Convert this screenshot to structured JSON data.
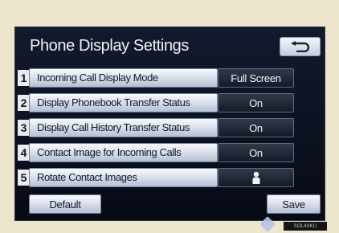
{
  "header": {
    "title": "Phone Display Settings",
    "back_icon": "return-arrow-icon"
  },
  "rows": [
    {
      "number": "1",
      "label": "Incoming Call Display Mode",
      "value": "Full Screen"
    },
    {
      "number": "2",
      "label": "Display Phonebook Transfer Status",
      "value": "On"
    },
    {
      "number": "3",
      "label": "Display Call History Transfer Status",
      "value": "On"
    },
    {
      "number": "4",
      "label": "Contact Image for Incoming Calls",
      "value": "On"
    },
    {
      "number": "5",
      "label": "Rotate Contact Images",
      "value": "",
      "value_icon": "person-icon"
    }
  ],
  "footer": {
    "default_label": "Default",
    "save_label": "Save"
  },
  "image_code": "SOL40KU",
  "colors": {
    "screen_bg": "#0a1020",
    "button_light": "#d6dbe7",
    "value_dark": "#1c2230",
    "page_bg": "#ece7cc"
  }
}
